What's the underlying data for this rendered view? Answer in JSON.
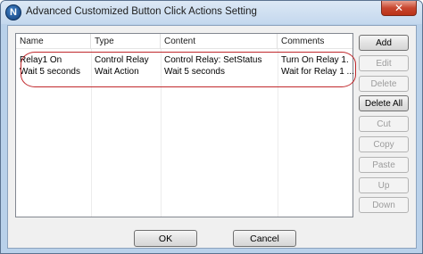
{
  "window": {
    "title": "Advanced Customized Button Click Actions Setting",
    "icon_letter": "N",
    "close_glyph": "✕"
  },
  "list": {
    "columns": [
      "Name",
      "Type",
      "Content",
      "Comments"
    ],
    "rows": [
      [
        "Relay1 On",
        "Control Relay",
        "Control Relay: SetStatus",
        "Turn On Relay 1."
      ],
      [
        "Wait 5 seconds",
        "Wait Action",
        "Wait 5 seconds",
        "Wait for Relay 1 ..."
      ]
    ]
  },
  "side_buttons": [
    {
      "label": "Add",
      "enabled": true
    },
    {
      "label": "Edit",
      "enabled": false
    },
    {
      "label": "Delete",
      "enabled": false
    },
    {
      "label": "Delete All",
      "enabled": true
    },
    {
      "label": "Cut",
      "enabled": false
    },
    {
      "label": "Copy",
      "enabled": false
    },
    {
      "label": "Paste",
      "enabled": false
    },
    {
      "label": "Up",
      "enabled": false
    },
    {
      "label": "Down",
      "enabled": false
    }
  ],
  "footer": {
    "ok_label": "OK",
    "cancel_label": "Cancel"
  },
  "colors": {
    "highlight": "#c0282c",
    "title_bg": "#dce8f5",
    "close_red": "#c8462f"
  }
}
